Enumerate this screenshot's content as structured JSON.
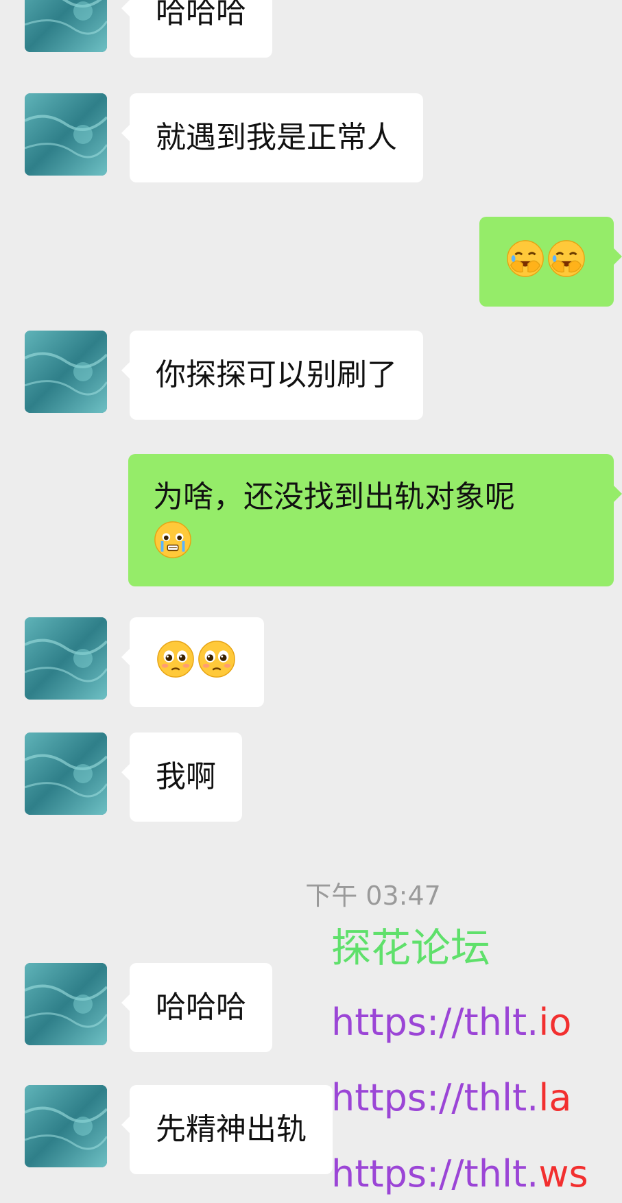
{
  "messages": [
    {
      "side": "left",
      "text": "哈哈哈"
    },
    {
      "side": "left",
      "text": "就遇到我是正常人"
    },
    {
      "side": "right",
      "emoji": [
        "face-with-hand-over-mouth-laughing",
        "face-with-hand-over-mouth-laughing"
      ]
    },
    {
      "side": "left",
      "text": "你探探可以别刷了"
    },
    {
      "side": "right",
      "text": "为啥，还没找到出轨对象呢",
      "emoji": [
        "holding-back-tears"
      ]
    },
    {
      "side": "left",
      "emoji": [
        "pleading-face",
        "pleading-face"
      ]
    },
    {
      "side": "left",
      "text": "我啊"
    },
    {
      "side": "left",
      "text": "哈哈哈"
    },
    {
      "side": "left",
      "text": "先精神出轨"
    }
  ],
  "timestamp": "下午 03:47",
  "watermark": {
    "title": "探花论坛",
    "urls": [
      {
        "prefix": "https://thlt.",
        "suffix": "io"
      },
      {
        "prefix": "https://thlt.",
        "suffix": "la"
      },
      {
        "prefix": "https://thlt.",
        "suffix": "ws"
      }
    ]
  },
  "colors": {
    "background": "#ededed",
    "bubble_left": "#ffffff",
    "bubble_right": "#95ec69",
    "timestamp": "#9a9a9a",
    "watermark_title": "#5fe06b",
    "watermark_url": "#9b45d6",
    "watermark_suffix": "#f22f2f"
  }
}
